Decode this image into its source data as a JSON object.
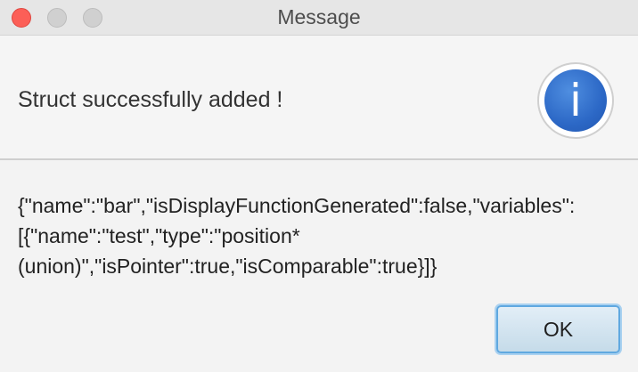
{
  "window": {
    "title": "Message"
  },
  "header": {
    "message": "Struct successfully added !",
    "icon": "info-icon",
    "icon_glyph": "i"
  },
  "content": {
    "text": "{\"name\":\"bar\",\"isDisplayFunctionGenerated\":false,\"variables\":[{\"name\":\"test\",\"type\":\"position*(union)\",\"isPointer\":true,\"isComparable\":true}]}"
  },
  "footer": {
    "ok_label": "OK"
  },
  "colors": {
    "close": "#fc5f57",
    "accent": "#5fa8e0",
    "info_blue": "#2c68c6"
  }
}
